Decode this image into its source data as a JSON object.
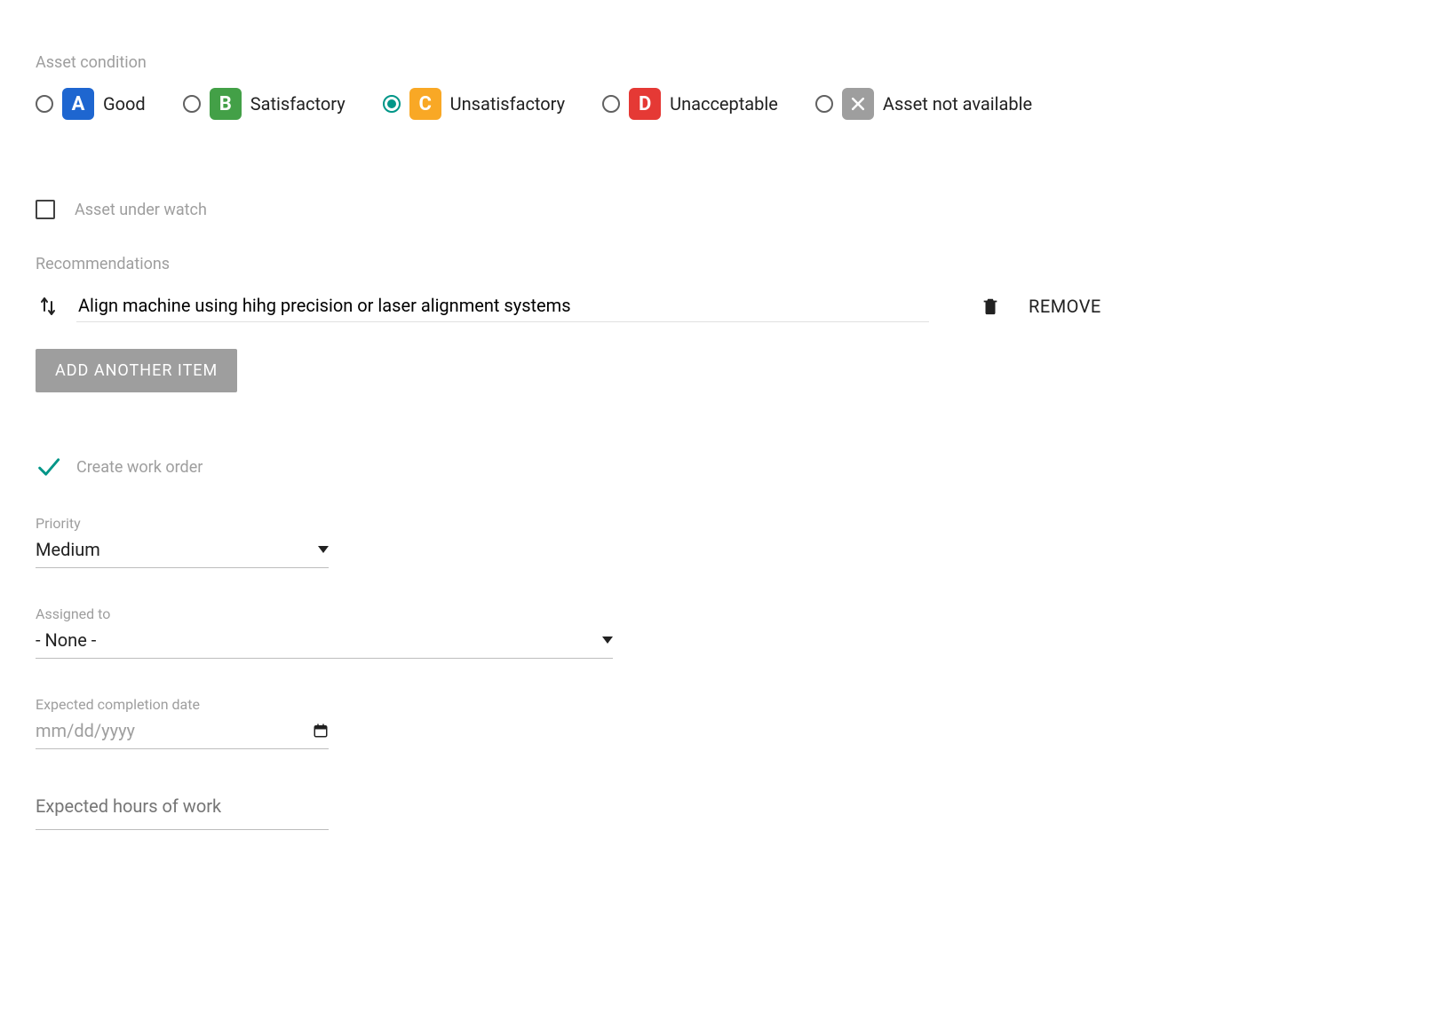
{
  "asset_condition": {
    "label": "Asset condition",
    "selected": "C",
    "options": [
      {
        "code": "A",
        "label": "Good"
      },
      {
        "code": "B",
        "label": "Satisfactory"
      },
      {
        "code": "C",
        "label": "Unsatisfactory"
      },
      {
        "code": "D",
        "label": "Unacceptable"
      },
      {
        "code": "X",
        "label": "Asset not available"
      }
    ]
  },
  "watch": {
    "label": "Asset under watch",
    "checked": false
  },
  "recommendations": {
    "label": "Recommendations",
    "items": [
      {
        "text": "Align machine using hihg precision or laser alignment systems"
      }
    ],
    "add_label": "ADD ANOTHER ITEM",
    "remove_label": "REMOVE"
  },
  "work_order": {
    "create_label": "Create work order",
    "checked": true,
    "priority": {
      "label": "Priority",
      "value": "Medium"
    },
    "assigned_to": {
      "label": "Assigned to",
      "value": "- None -"
    },
    "expected_completion": {
      "label": "Expected completion date",
      "placeholder": "mm/dd/yyyy",
      "value": ""
    },
    "expected_hours": {
      "label": "Expected hours of work",
      "value": ""
    }
  }
}
